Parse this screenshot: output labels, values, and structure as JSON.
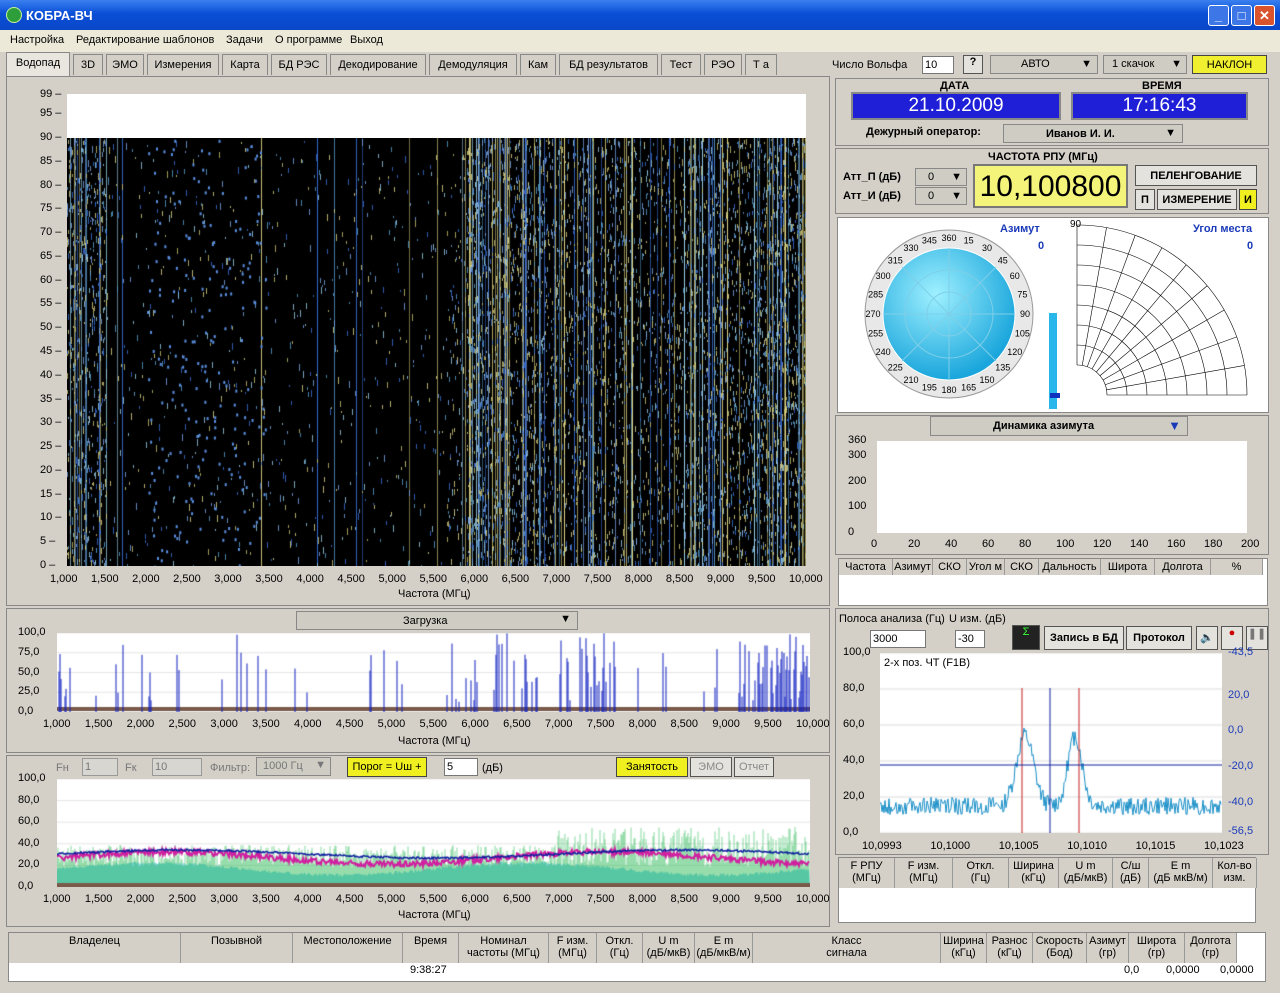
{
  "window": {
    "title": "КОБРА-ВЧ"
  },
  "menu": [
    "Настройка",
    "Редактирование шаблонов",
    "Задачи",
    "О программе",
    "Выход"
  ],
  "tabs": [
    "Водопад",
    "3D",
    "ЭМО",
    "Измерения",
    "Карта",
    "БД РЭС",
    "Декодирование",
    "Демодуляция",
    "Кам",
    "БД результатов",
    "Тест",
    "РЭО",
    "Т а"
  ],
  "top_controls": {
    "wolf_label": "Число Вольфа",
    "wolf_value": "10",
    "help": "?",
    "mode": "АВТО",
    "step": "1 скачок",
    "tilt": "НАКЛОН"
  },
  "info": {
    "date_label": "ДАТА",
    "date": "21.10.2009",
    "time_label": "ВРЕМЯ",
    "time": "17:16:43",
    "operator_label": "Дежурный оператор:",
    "operator": "Иванов И. И."
  },
  "rpu": {
    "att_p_label": "Атт_П (дБ)",
    "att_p": "0",
    "att_i_label": "Атт_И (дБ)",
    "att_i": "0",
    "freq_label": "ЧАСТОТА РПУ (МГц)",
    "freq": "10,100800",
    "peleng": "ПЕЛЕНГОВАНИЕ",
    "p": "П",
    "measure": "ИЗМЕРЕНИЕ",
    "i": "И"
  },
  "azimuth": {
    "label": "Азимут",
    "value": "0",
    "ticks": [
      "345",
      "360",
      "15",
      "30",
      "45",
      "60",
      "75",
      "90",
      "105",
      "120",
      "135",
      "150",
      "165",
      "180",
      "195",
      "210",
      "225",
      "240",
      "255",
      "270",
      "285",
      "300",
      "315",
      "330"
    ],
    "elev_label": "Угол места",
    "elev_value": "0",
    "elev_top": "90"
  },
  "dynamics": {
    "title": "Динамика азимута",
    "yticks": [
      "360",
      "300",
      "200",
      "100",
      "0"
    ],
    "xticks": [
      "0",
      "20",
      "40",
      "60",
      "80",
      "100",
      "120",
      "140",
      "160",
      "180",
      "200"
    ]
  },
  "result_table": {
    "headers": [
      "Частота",
      "Азимут",
      "СКО",
      "Угол м",
      "СКО",
      "Дальность",
      "Широта",
      "Долгота",
      "%"
    ]
  },
  "waterfall": {
    "yticks": [
      "99",
      "95",
      "90",
      "85",
      "80",
      "75",
      "70",
      "65",
      "60",
      "55",
      "50",
      "45",
      "40",
      "35",
      "30",
      "25",
      "20",
      "15",
      "10",
      "5",
      "0"
    ],
    "xticks": [
      "1,000",
      "1,500",
      "2,000",
      "2,500",
      "3,000",
      "3,500",
      "4,000",
      "4,500",
      "5,000",
      "5,500",
      "6,000",
      "6,500",
      "7,000",
      "7,500",
      "8,000",
      "8,500",
      "9,000",
      "9,500",
      "10,000"
    ],
    "xlabel": "Частота (МГц)"
  },
  "load": {
    "dropdown": "Загрузка",
    "yticks": [
      "100,0",
      "75,0",
      "50,0",
      "25,0",
      "0,0"
    ],
    "xlabel": "Частота (МГц)"
  },
  "occupancy": {
    "fn_label": "Fн",
    "fn": "1",
    "fk_label": "Fк",
    "fk": "10",
    "filter_label": "Фильтр:",
    "filter": "1000 Гц",
    "threshold": "Порог = Uш +",
    "threshold_value": "5",
    "threshold_unit": "(дБ)",
    "busy": "Занятость",
    "emo": "ЭМО",
    "report": "Отчет",
    "yticks": [
      "100,0",
      "80,0",
      "60,0",
      "40,0",
      "20,0",
      "0,0"
    ],
    "xlabel": "Частота (МГц)"
  },
  "analysis": {
    "band_label": "Полоса анализа (Гц)",
    "band": "3000",
    "u_label": "U изм. (дБ)",
    "u": "-30",
    "record": "Запись в БД",
    "protocol": "Протокол",
    "signal": "2-х поз. ЧТ (F1B)",
    "yticks_left": [
      "100,0",
      "80,0",
      "60,0",
      "40,0",
      "20,0",
      "0,0"
    ],
    "yticks_right": [
      "-43,5",
      "20,0",
      "0,0",
      "-20,0",
      "-40,0",
      "-56,5"
    ],
    "xticks": [
      "10,0993",
      "10,1000",
      "10,1005",
      "10,1010",
      "10,1015",
      "10,1023"
    ]
  },
  "meas_table": {
    "headers": [
      "F РПУ\n(МГц)",
      "F изм.\n(МГц)",
      "Откл.\n(Гц)",
      "Ширина\n(кГц)",
      "U m\n(дБ/мкВ)",
      "С/ш\n(дБ)",
      "E m\n(дБ мкВ/м)",
      "Кол-во\nизм."
    ]
  },
  "bottom_table": {
    "headers": [
      "Владелец",
      "Позывной",
      "Местоположение",
      "Время",
      "Номинал\nчастоты (МГц)",
      "F изм.\n(МГц)",
      "Откл.\n(Гц)",
      "U m\n(дБ/мкВ)",
      "E m\n(дБ/мкВ/м)",
      "Класс\nсигнала",
      "Ширина\n(кГц)",
      "Разнос\n(кГц)",
      "Скорость\n(Бод)",
      "Азимут\n(гр)",
      "Широта\n(гр)",
      "Долгота\n(гр)"
    ],
    "row": {
      "time": "9:38:27",
      "az": "0,0",
      "lat": "0,0000",
      "lon": "0,0000"
    }
  }
}
